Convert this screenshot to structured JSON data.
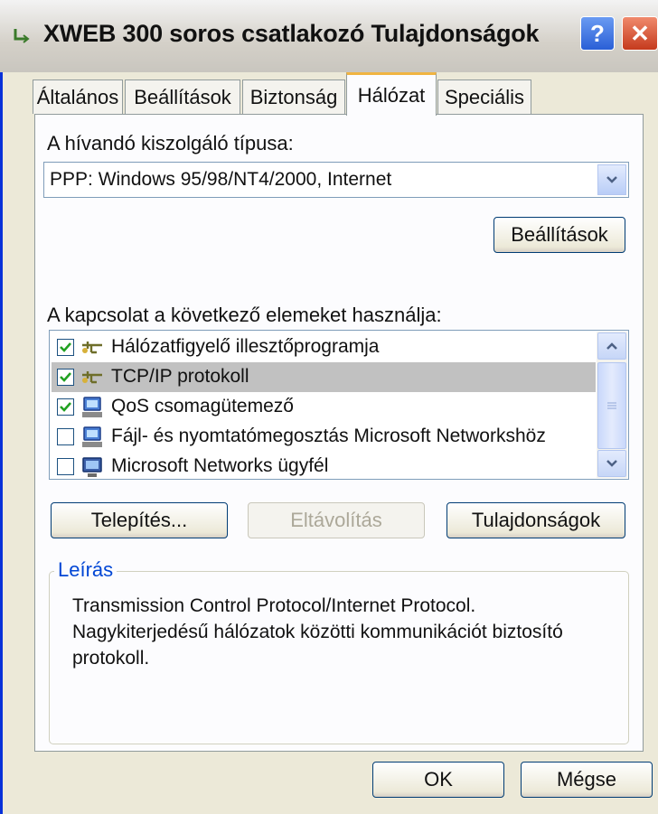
{
  "window": {
    "title": "XWEB 300 soros csatlakozó Tulajdonságok",
    "help_label": "?",
    "close_label": "✕"
  },
  "tabs": [
    {
      "label": "Általános",
      "active": false
    },
    {
      "label": "Beállítások",
      "active": false
    },
    {
      "label": "Biztonság",
      "active": false
    },
    {
      "label": "Hálózat",
      "active": true
    },
    {
      "label": "Speciális",
      "active": false
    }
  ],
  "server_type": {
    "label": "A hívandó kiszolgáló típusa:",
    "selected": "PPP: Windows 95/98/NT4/2000, Internet",
    "settings_button": "Beállítások"
  },
  "components": {
    "label": "A kapcsolat a következő elemeket használja:",
    "items": [
      {
        "label": "Hálózatfigyelő illesztőprogramja",
        "checked": true,
        "icon": "network-protocol-icon",
        "selected": false
      },
      {
        "label": "TCP/IP protokoll",
        "checked": true,
        "icon": "network-protocol-icon",
        "selected": true
      },
      {
        "label": "QoS csomagütemező",
        "checked": true,
        "icon": "network-service-icon",
        "selected": false
      },
      {
        "label": "Fájl- és nyomtatómegosztás Microsoft Networkshöz",
        "checked": false,
        "icon": "network-service-icon",
        "selected": false
      },
      {
        "label": "Microsoft Networks ügyfél",
        "checked": false,
        "icon": "network-client-icon",
        "selected": false
      }
    ]
  },
  "buttons": {
    "install": "Telepítés...",
    "uninstall": "Eltávolítás",
    "properties": "Tulajdonságok",
    "ok": "OK",
    "cancel": "Mégse"
  },
  "description": {
    "legend": "Leírás",
    "text": "Transmission Control Protocol/Internet Protocol. Nagykiterjedésű hálózatok közötti kommunikációt biztosító protokoll."
  },
  "colors": {
    "accent": "#0046d5",
    "active_tab_border": "#f0b441",
    "selection": "#c1c1c1"
  }
}
